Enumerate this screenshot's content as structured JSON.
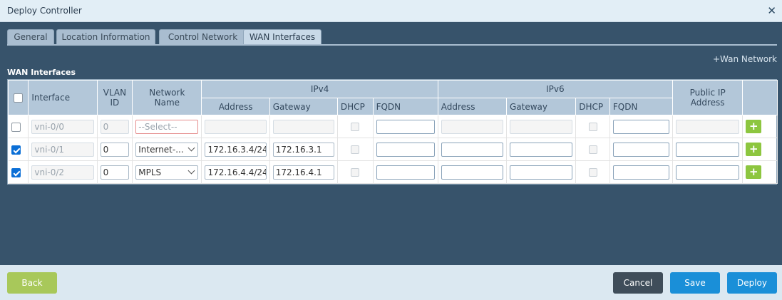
{
  "window": {
    "title": "Deploy Controller"
  },
  "tabs": [
    {
      "label": "General"
    },
    {
      "label": "Location Information"
    },
    {
      "label": "Control Network"
    },
    {
      "label": "WAN Interfaces",
      "active": true
    }
  ],
  "wan_network_link": "+Wan Network",
  "section_title": "WAN Interfaces",
  "table": {
    "headers": {
      "interface": "Interface",
      "vlan_id": "VLAN ID",
      "network_name": "Network Name",
      "ipv4": "IPv4",
      "ipv6": "IPv6",
      "public_ip": "Public IP Address",
      "address": "Address",
      "gateway": "Gateway",
      "dhcp": "DHCP",
      "fqdn": "FQDN"
    },
    "rows": [
      {
        "checked": false,
        "interface": "vni-0/0",
        "vlan": "0",
        "network": "--Select--",
        "ipv4_address": "",
        "ipv4_gateway": "",
        "fqdn4": "",
        "ipv6_address": "",
        "ipv6_gateway": "",
        "fqdn6": "",
        "public_ip": ""
      },
      {
        "checked": true,
        "interface": "vni-0/1",
        "vlan": "0",
        "network": "Internet-...",
        "ipv4_address": "172.16.3.4/24",
        "ipv4_gateway": "172.16.3.1",
        "fqdn4": "",
        "ipv6_address": "",
        "ipv6_gateway": "",
        "fqdn6": "",
        "public_ip": ""
      },
      {
        "checked": true,
        "interface": "vni-0/2",
        "vlan": "0",
        "network": "MPLS",
        "ipv4_address": "172.16.4.4/24",
        "ipv4_gateway": "172.16.4.1",
        "fqdn4": "",
        "ipv6_address": "",
        "ipv6_gateway": "",
        "fqdn6": "",
        "public_ip": ""
      }
    ],
    "add_label": "+"
  },
  "footer": {
    "back": "Back",
    "cancel": "Cancel",
    "save": "Save",
    "deploy": "Deploy"
  },
  "colors": {
    "header_bg": "#37536b",
    "accent_blue": "#1a8fd8",
    "add_green": "#8dc63f",
    "back_green": "#a8c85a",
    "cancel_dark": "#3f4d5a"
  },
  "icons": {
    "close": "close-icon",
    "add": "plus-icon",
    "dropdown": "chevron-down-icon"
  }
}
